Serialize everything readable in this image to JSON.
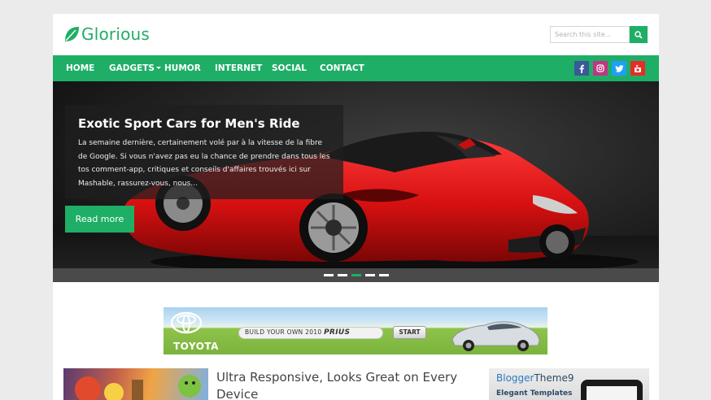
{
  "site": {
    "title": "Glorious"
  },
  "search": {
    "placeholder": "Search this site...",
    "icon": "search-icon"
  },
  "nav": {
    "items": [
      {
        "label": "HOME"
      },
      {
        "label": "GADGETS",
        "has_dropdown": true
      },
      {
        "label": "HUMOR"
      },
      {
        "label": "INTERNET"
      },
      {
        "label": "SOCIAL"
      },
      {
        "label": "CONTACT"
      }
    ],
    "social": [
      {
        "name": "facebook-icon",
        "color": "#3b5998"
      },
      {
        "name": "instagram-icon",
        "color": "#c13584"
      },
      {
        "name": "twitter-icon",
        "color": "#1da1f2"
      },
      {
        "name": "youtube-icon",
        "color": "#e52d27"
      }
    ]
  },
  "slider": {
    "title": "Exotic Sport Cars for Men's Ride",
    "description": "La semaine dernière, certainement volé par à la vitesse de la fibre de Google. Si vous n'avez pas eu la chance de prendre dans tous les tos comment-app, critiques et conseils d'affaires trouvés ici sur Mashable, rassurez-vous, nous...",
    "button_label": "Read more",
    "slide_count": 5,
    "active_slide": 3
  },
  "ad": {
    "brand": "TOYOTA",
    "text": "BUILD YOUR OWN 2010",
    "model": "PRIUS",
    "button_label": "START"
  },
  "post": {
    "title": "Ultra Responsive, Looks Great on Every Device"
  },
  "widget": {
    "brand_part1": "Blogger",
    "brand_part2": "Theme9",
    "subtitle": "Elegant Templates"
  },
  "colors": {
    "accent": "#1fae66",
    "background": "#ebebeb",
    "slider_overlay": "#1e1e1e"
  }
}
